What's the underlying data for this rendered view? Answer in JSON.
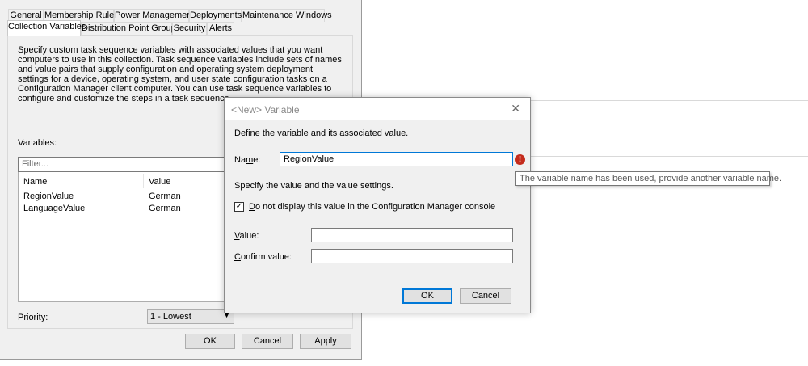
{
  "props": {
    "tabs_row1": [
      "General",
      "Membership Rules",
      "Power Management",
      "Deployments",
      "Maintenance Windows"
    ],
    "tabs_row2": [
      "Collection Variables",
      "Distribution Point Groups",
      "Security",
      "Alerts"
    ],
    "description": "Specify custom task sequence variables with associated values that you want computers to use in this collection. Task sequence variables include sets of names and value pairs that supply configuration and operating system deployment settings for a device, operating system, and user state configuration tasks on a Configuration Manager client computer. You can use task sequence variables to configure and customize the steps in a task sequence.",
    "variables_label": "Variables:",
    "filter_placeholder": "Filter...",
    "columns": [
      "Name",
      "Value"
    ],
    "rows": [
      {
        "name": "RegionValue",
        "value": "German"
      },
      {
        "name": "LanguageValue",
        "value": "German"
      }
    ],
    "priority_label": "Priority:",
    "priority_value": "1 - Lowest",
    "ok": "OK",
    "cancel": "Cancel",
    "apply": "Apply"
  },
  "modal": {
    "title": "<New> Variable",
    "close": "✕",
    "intro": "Define the variable and its associated value.",
    "name_label_pre": "Na",
    "name_label_key": "m",
    "name_label_post": "e:",
    "name_value": "RegionValue",
    "settings_text": "Specify the value and the value settings.",
    "checkbox_key": "D",
    "checkbox_rest": "o not display this value in the Configuration Manager console",
    "checkbox_checked": "✓",
    "value_label_key": "V",
    "value_label_rest": "alue:",
    "confirm_label_key": "C",
    "confirm_label_rest": "onfirm value:",
    "ok": "OK",
    "cancel": "Cancel",
    "error_icon": "!",
    "tooltip": "The variable name has been used, provide another variable name."
  },
  "colors": {
    "accent": "#0078d7",
    "error": "#c42b1c"
  }
}
